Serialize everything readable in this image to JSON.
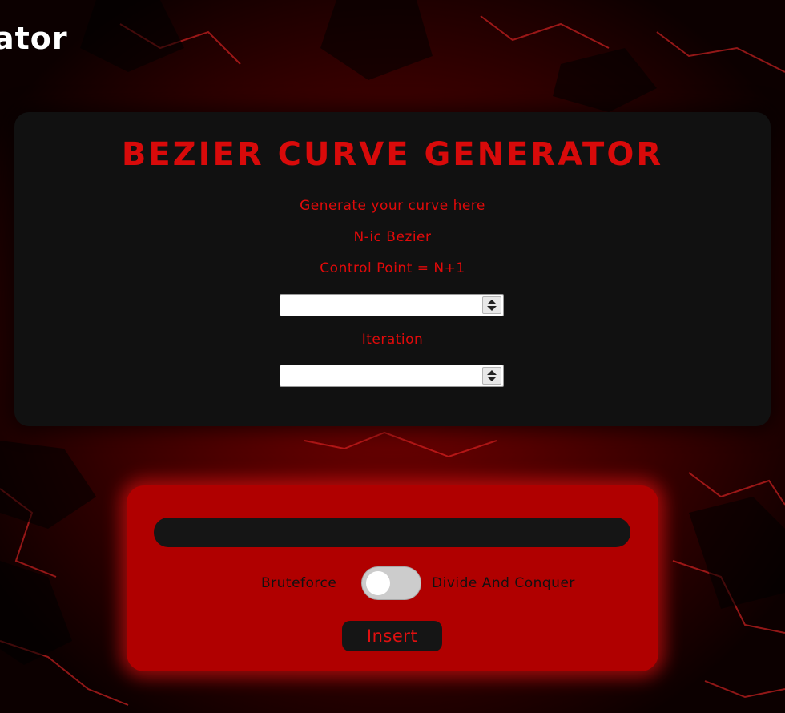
{
  "header": {
    "logo_text": "ator"
  },
  "generator": {
    "title": "Bezier Curve Generator",
    "subtitle": "Generate your curve here",
    "curve_type": "N-ic Bezier",
    "control_point_label": "Control Point = N+1",
    "control_point_value": "",
    "iteration_label": "Iteration",
    "iteration_value": ""
  },
  "insert_panel": {
    "points_value": "",
    "toggle_left_label": "Bruteforce",
    "toggle_right_label": "Divide And Conquer",
    "toggle_state": "off",
    "insert_label": "Insert"
  },
  "colors": {
    "accent": "#e00a0a",
    "panel_dark": "#111111",
    "panel_red": "#b00000",
    "background": "#1a0000"
  },
  "icons": {
    "spinner_up": "chevron-up-icon",
    "spinner_down": "chevron-down-icon"
  }
}
